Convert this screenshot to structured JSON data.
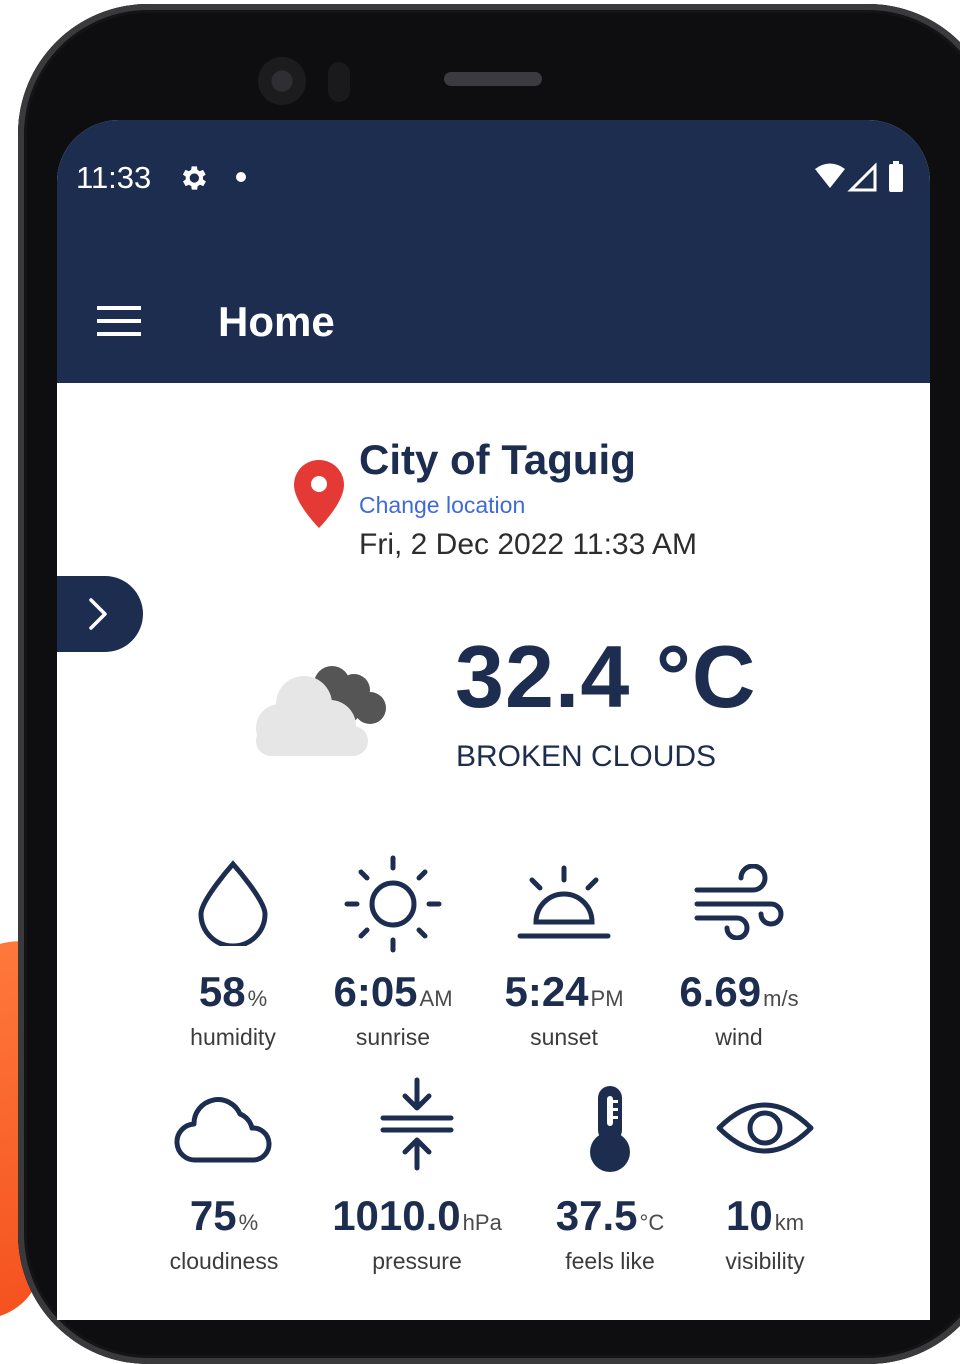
{
  "status_bar": {
    "time": "11:33"
  },
  "app_bar": {
    "title": "Home"
  },
  "location": {
    "city": "City of Taguig",
    "change_label": "Change location",
    "datetime": "Fri, 2 Dec 2022 11:33 AM"
  },
  "current": {
    "temperature": "32.4 °C",
    "condition": "BROKEN CLOUDS",
    "icon": "broken-clouds-icon"
  },
  "stats": [
    {
      "value": "58",
      "unit": "%",
      "label": "humidity",
      "icon": "humidity-drop-icon"
    },
    {
      "value": "6:05",
      "unit": "AM",
      "label": "sunrise",
      "icon": "sunrise-icon"
    },
    {
      "value": "5:24",
      "unit": "PM",
      "label": "sunset",
      "icon": "sunset-icon"
    },
    {
      "value": "6.69",
      "unit": "m/s",
      "label": "wind",
      "icon": "wind-icon"
    },
    {
      "value": "75",
      "unit": "%",
      "label": "cloudiness",
      "icon": "cloud-icon"
    },
    {
      "value": "1010.0",
      "unit": "hPa",
      "label": "pressure",
      "icon": "pressure-icon"
    },
    {
      "value": "37.5",
      "unit": "°C",
      "label": "feels like",
      "icon": "thermometer-icon"
    },
    {
      "value": "10",
      "unit": "km",
      "label": "visibility",
      "icon": "eye-icon"
    }
  ],
  "colors": {
    "primary": "#1c2d4f",
    "link": "#3f6ad8",
    "pin": "#e53935",
    "accent_orange": "#f4511e"
  }
}
